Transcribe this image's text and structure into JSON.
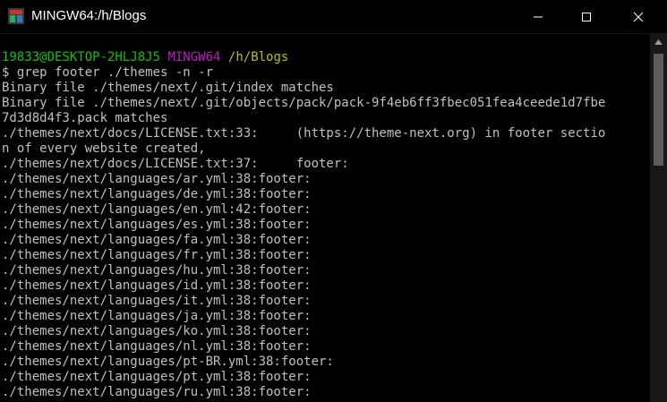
{
  "window": {
    "title": "MINGW64:/h/Blogs"
  },
  "prompt": {
    "user_host": "19833@DESKTOP-2HLJ8J5",
    "shell": "MINGW64",
    "cwd": "/h/Blogs",
    "command": "$ grep footer ./themes -n -r"
  },
  "output": [
    "Binary file ./themes/next/.git/index matches",
    "Binary file ./themes/next/.git/objects/pack/pack-9f4eb6ff3fbec051fea4ceede1d7fbe",
    "7d3d8d4f3.pack matches",
    "./themes/next/docs/LICENSE.txt:33:     (https://theme-next.org) in footer sectio",
    "n of every website created,",
    "./themes/next/docs/LICENSE.txt:37:     footer:",
    "./themes/next/languages/ar.yml:38:footer:",
    "./themes/next/languages/de.yml:38:footer:",
    "./themes/next/languages/en.yml:42:footer:",
    "./themes/next/languages/es.yml:38:footer:",
    "./themes/next/languages/fa.yml:38:footer:",
    "./themes/next/languages/fr.yml:38:footer:",
    "./themes/next/languages/hu.yml:38:footer:",
    "./themes/next/languages/id.yml:38:footer:",
    "./themes/next/languages/it.yml:38:footer:",
    "./themes/next/languages/ja.yml:38:footer:",
    "./themes/next/languages/ko.yml:38:footer:",
    "./themes/next/languages/nl.yml:38:footer:",
    "./themes/next/languages/pt-BR.yml:38:footer:",
    "./themes/next/languages/pt.yml:38:footer:",
    "./themes/next/languages/ru.yml:38:footer:"
  ],
  "colors": {
    "user_host": "#13c10e",
    "shell": "#b81ebf",
    "cwd": "#c1bb10",
    "text": "#c0c0c0"
  },
  "icons": {
    "app": "mingw-icon",
    "minimize": "minimize-icon",
    "maximize": "maximize-icon",
    "close": "close-icon",
    "scroll_up": "scroll-up-arrow-icon"
  }
}
